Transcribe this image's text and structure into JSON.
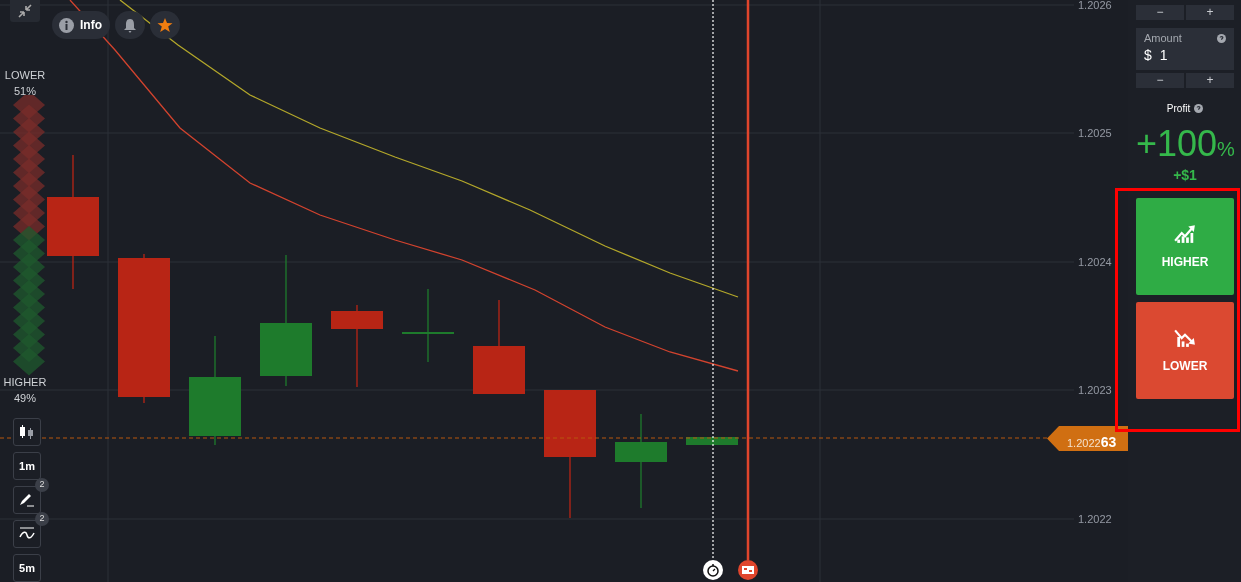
{
  "toolbar": {
    "info_label": "Info",
    "favorite": true
  },
  "sentiment": {
    "lower_label": "LOWER",
    "lower_percent": "51%",
    "higher_label": "HIGHER",
    "higher_percent": "49%",
    "level": 0.51
  },
  "chart_tools": [
    {
      "kind": "candles"
    },
    {
      "kind": "text",
      "label": "1m"
    },
    {
      "kind": "draw",
      "badge": "2"
    },
    {
      "kind": "indicator",
      "badge": "2"
    },
    {
      "kind": "text",
      "label": "5m"
    }
  ],
  "price_axis": [
    "1.2026",
    "1.2025",
    "1.2024",
    "1.2023",
    "1.2022"
  ],
  "current_price": "1.2022**63**",
  "trade_panel": {
    "top_stepper": [
      "−",
      "+"
    ],
    "amount": {
      "label": "Amount",
      "currency": "$",
      "value": "1"
    },
    "amount_stepper": [
      "−",
      "+"
    ],
    "profit_label": "Profit",
    "profit_percent": "+100",
    "percent_sign": "%",
    "profit_amount": "+$1",
    "buttons": [
      {
        "kind": "higher",
        "label": "HIGHER"
      },
      {
        "kind": "lower",
        "label": "LOWER"
      }
    ]
  },
  "highlight_frame": true
}
